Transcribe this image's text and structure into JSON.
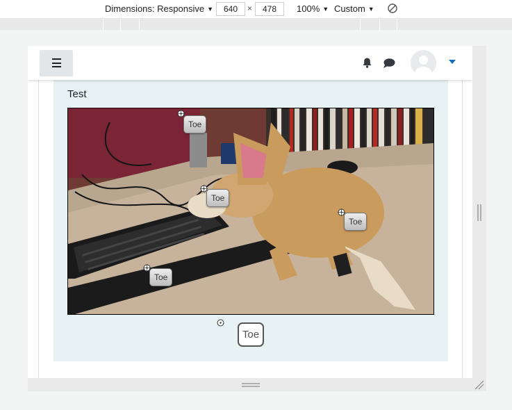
{
  "devtools": {
    "dimensions_label": "Dimensions: Responsive",
    "width": "640",
    "times": "×",
    "height": "478",
    "zoom": "100%",
    "throttle": "Custom",
    "rotate_icon": "rotate-icon"
  },
  "nav": {
    "menu_icon": "hamburger-icon",
    "notifications_icon": "bell-icon",
    "messages_icon": "chat-icon",
    "user_icon": "avatar"
  },
  "question": {
    "text": "Test",
    "placed_labels": [
      "Toe",
      "Toe",
      "Toe",
      "Toe"
    ],
    "home_label": "Toe"
  },
  "colors": {
    "question_bg": "#e6f2f3",
    "caret": "#0f6cbf"
  }
}
